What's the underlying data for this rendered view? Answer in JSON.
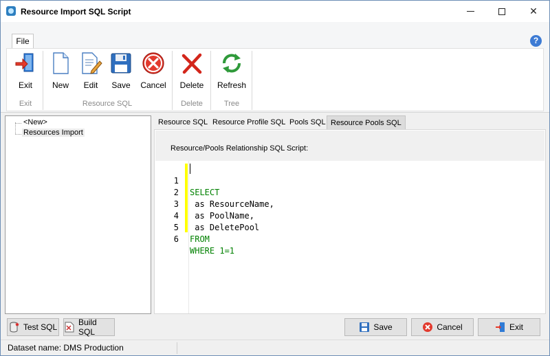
{
  "window": {
    "title": "Resource Import SQL Script"
  },
  "ribbon": {
    "file_tab": "File",
    "buttons": {
      "exit": "Exit",
      "new": "New",
      "edit": "Edit",
      "save": "Save",
      "cancel": "Cancel",
      "delete": "Delete",
      "refresh": "Refresh"
    },
    "groups": {
      "exit": "Exit",
      "resource_sql": "Resource SQL",
      "delete": "Delete",
      "tree": "Tree"
    },
    "icons": {
      "exit": "exit-door-icon",
      "new": "new-document-icon",
      "edit": "edit-document-icon",
      "save": "floppy-disk-icon",
      "cancel": "cancel-circle-icon",
      "delete": "red-x-icon",
      "refresh": "refresh-arrows-icon",
      "help": "help-icon"
    }
  },
  "tree": {
    "items": [
      "<New>",
      "Resources Import"
    ],
    "selected": "Resources Import"
  },
  "tabs": [
    {
      "label": "Resource SQL",
      "active": false
    },
    {
      "label": "Resource Profile SQL",
      "active": false
    },
    {
      "label": "Pools SQL",
      "active": false
    },
    {
      "label": "Resource Pools SQL",
      "active": true
    }
  ],
  "panel": {
    "caption": "Resource/Pools Relationship SQL Script:"
  },
  "editor": {
    "lines": [
      {
        "number": "1",
        "text": "SELECT"
      },
      {
        "number": "2",
        "text": " as ResourceName,"
      },
      {
        "number": "3",
        "text": " as PoolName,"
      },
      {
        "number": "4",
        "text": " as DeletePool"
      },
      {
        "number": "5",
        "text": "FROM"
      },
      {
        "number": "6",
        "text": "WHERE 1=1"
      }
    ]
  },
  "bottom_buttons": {
    "test_sql": "Test SQL",
    "build_sql": "Build SQL",
    "save": "Save",
    "cancel": "Cancel",
    "exit": "Exit"
  },
  "status": {
    "dataset_label": "Dataset name:",
    "dataset_value": "DMS Production"
  },
  "colors": {
    "keyword": "#008000",
    "number": "#c000c0",
    "change_marker": "#ffff00",
    "active_tab": "#dcdcdc"
  }
}
